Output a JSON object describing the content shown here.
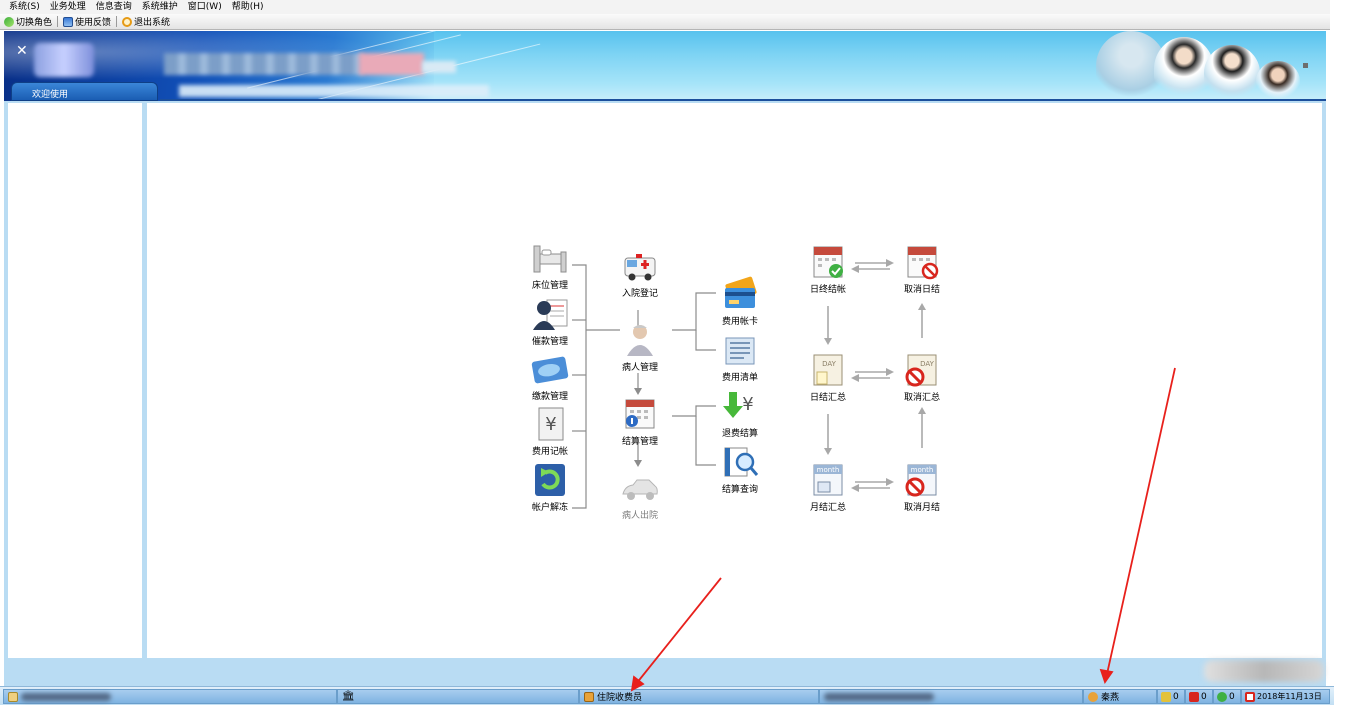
{
  "menu": {
    "items": [
      "系统(S)",
      "业务处理",
      "信息查询",
      "系统维护",
      "窗口(W)",
      "帮助(H)"
    ]
  },
  "toolbar": {
    "switch_role": "切换角色",
    "feedback": "使用反馈",
    "exit": "退出系统"
  },
  "tab": {
    "welcome": "欢迎使用"
  },
  "flow": {
    "left_column": [
      "床位管理",
      "催款管理",
      "缴款管理",
      "费用记帐",
      "帐户解冻"
    ],
    "center_column": [
      "入院登记",
      "病人管理",
      "结算管理",
      "病人出院"
    ],
    "right_column": [
      "费用帐卡",
      "费用清单",
      "退费结算",
      "结算查询"
    ],
    "summary": {
      "day_close": "日终结帐",
      "cancel_day": "取消日结",
      "day_summary": "日结汇总",
      "cancel_summary": "取消汇总",
      "month_summary": "月结汇总",
      "cancel_month": "取消月结",
      "day_icon_text": "DAY",
      "month_icon_text": "month"
    }
  },
  "status": {
    "role": "住院收费员",
    "user": "秦燕",
    "count_1": "0",
    "count_2": "0",
    "count_3": "0",
    "date": "2018年11月13日"
  },
  "colors": {
    "banner_dark": "#1150b8",
    "banner_light": "#a6e4f9",
    "annotation_arrow": "#e8201c",
    "status_bar": "#7fb3e1"
  },
  "icons": [
    "switch-role-icon",
    "feedback-icon",
    "exit-icon",
    "bank-icon",
    "user-icon",
    "pencil-icon",
    "message-icon",
    "online-icon",
    "calendar-icon"
  ]
}
